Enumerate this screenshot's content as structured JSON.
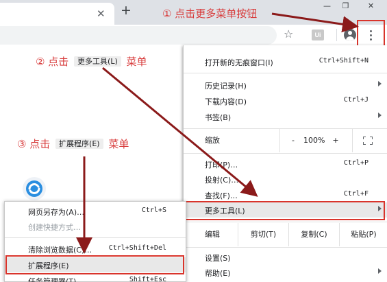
{
  "tabstrip": {
    "close_glyph": "✕",
    "new_tab_glyph": "+"
  },
  "window": {
    "minimize_glyph": "—",
    "restore_glyph": "❐",
    "close_glyph": "✕"
  },
  "toolbar": {
    "star_icon": "star-icon",
    "extension_label": "Ui",
    "avatar_icon": "avatar-icon",
    "menu_icon": "kebab-menu-icon"
  },
  "annotations": {
    "step1": {
      "num": "①",
      "text": "点击更多菜单按钮"
    },
    "step2": {
      "num": "②",
      "pre": "点击",
      "chip": "更多工具(L)",
      "post": "菜单"
    },
    "step3": {
      "num": "③",
      "pre": "点击",
      "chip": "扩展程序(E)",
      "post": "菜单"
    },
    "color": "#d83c3c",
    "arrow_color": "#8b1a1a",
    "box_color": "#d9342b"
  },
  "menu": {
    "new_incognito": {
      "label": "打开新的无痕窗口(I)",
      "shortcut": "Ctrl+Shift+N"
    },
    "history": {
      "label": "历史记录(H)"
    },
    "downloads": {
      "label": "下载内容(D)",
      "shortcut": "Ctrl+J"
    },
    "bookmarks": {
      "label": "书签(B)"
    },
    "zoom": {
      "label": "缩放",
      "minus": "-",
      "value": "100%",
      "plus": "+"
    },
    "print": {
      "label": "打印(P)…",
      "shortcut": "Ctrl+P"
    },
    "cast": {
      "label": "投射(C)…"
    },
    "find": {
      "label": "查找(F)…",
      "shortcut": "Ctrl+F"
    },
    "more_tools": {
      "label": "更多工具(L)"
    },
    "edit": {
      "label": "编辑",
      "cut": "剪切(T)",
      "copy": "复制(C)",
      "paste": "粘贴(P)"
    },
    "settings": {
      "label": "设置(S)"
    },
    "help": {
      "label": "帮助(E)"
    }
  },
  "submenu": {
    "save_as": {
      "label": "网页另存为(A)…",
      "shortcut": "Ctrl+S"
    },
    "create_shortcut": {
      "label": "创建快捷方式…"
    },
    "clear_data": {
      "label": "清除浏览数据(C)…",
      "shortcut": "Ctrl+Shift+Del"
    },
    "extensions": {
      "label": "扩展程序(E)"
    },
    "task_manager": {
      "label": "任务管理器(T)",
      "shortcut": "Shift+Esc"
    }
  }
}
